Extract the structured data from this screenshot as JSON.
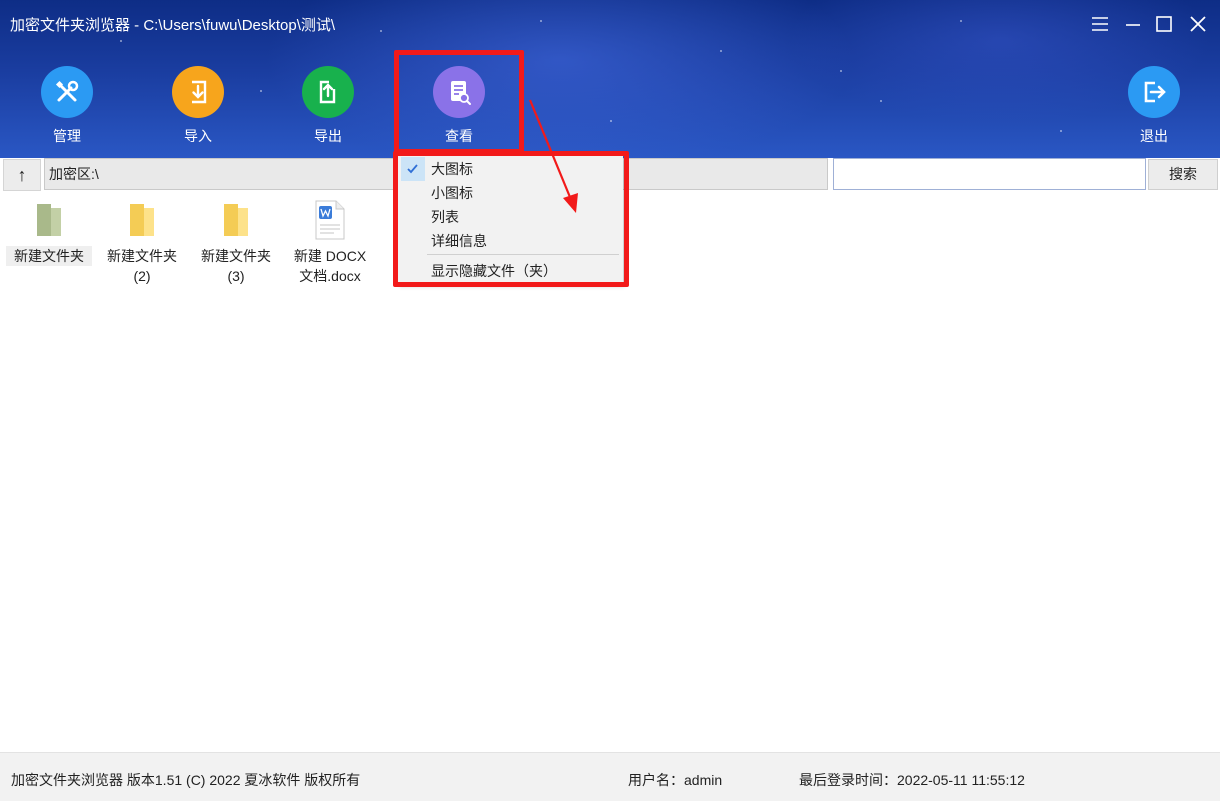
{
  "window": {
    "title": "加密文件夹浏览器  - C:\\Users\\fuwu\\Desktop\\测试\\",
    "controls": [
      "menu-icon",
      "minimize-icon",
      "maximize-icon",
      "close-icon"
    ]
  },
  "toolbar": {
    "items": [
      {
        "label": "管理",
        "icon": "tools-icon",
        "color": "#2b9af3"
      },
      {
        "label": "导入",
        "icon": "import-icon",
        "color": "#f7a51c"
      },
      {
        "label": "导出",
        "icon": "export-icon",
        "color": "#18b14d"
      },
      {
        "label": "查看",
        "icon": "view-document-icon",
        "color": "#8a72e8"
      },
      {
        "label": "退出",
        "icon": "exit-icon",
        "color": "#2b9af3"
      }
    ]
  },
  "address": {
    "up_label": "↑",
    "path": "加密区:\\",
    "search_value": "",
    "search_button": "搜索"
  },
  "files": [
    {
      "name_line1": "新建文件夹",
      "name_line2": "",
      "icon": "folder-icon-green",
      "selected": true
    },
    {
      "name_line1": "新建文件夹",
      "name_line2": "(2)",
      "icon": "folder-icon",
      "selected": false
    },
    {
      "name_line1": "新建文件夹",
      "name_line2": "(3)",
      "icon": "folder-icon",
      "selected": false
    },
    {
      "name_line1": "新建 DOCX",
      "name_line2": "文档.docx",
      "icon": "word-document-icon",
      "selected": false
    }
  ],
  "view_menu": {
    "items": [
      {
        "label": "大图标",
        "checked": true
      },
      {
        "label": "小图标",
        "checked": false
      },
      {
        "label": "列表",
        "checked": false
      },
      {
        "label": "详细信息",
        "checked": false
      }
    ],
    "extra_item": "显示隐藏文件（夹）"
  },
  "status": {
    "app_info": "加密文件夹浏览器 版本1.51 (C) 2022 夏冰软件 版权所有",
    "user": "用户名：admin",
    "last_login": "最后登录时间：2022-05-11 11:55:12"
  },
  "colors": {
    "highlight_red": "#f21a1a",
    "header_blue": "#1a3da0",
    "menu_check_bg": "#cce4f7"
  }
}
